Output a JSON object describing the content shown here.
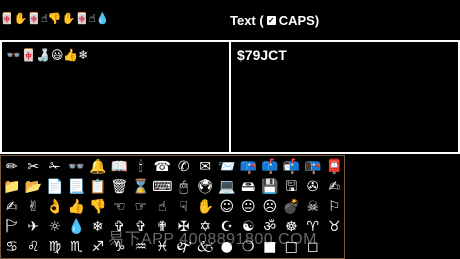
{
  "header": {
    "emoji_strip": "🀄✋🀄☝👎✋🀄☝💧",
    "text_label_prefix": "Text (",
    "checkbox_mark": "✓",
    "caps_label": " CAPS)"
  },
  "left_panel": {
    "emoji_row": "👓🀄🍶😃👍❄"
  },
  "right_panel": {
    "value": "$79JCT"
  },
  "symbol_grid": {
    "rows": [
      [
        "✏",
        "✂",
        "✁",
        "👓",
        "🔔",
        "📖",
        "🕯",
        "☎",
        "✆",
        "✉",
        "📨",
        "📪",
        "📫",
        "📬",
        "📭",
        "📮"
      ],
      [
        "📁",
        "📂",
        "📄",
        "📃",
        "📋",
        "🗑",
        "⌛",
        "⌨",
        "🖱",
        "🖲",
        "💻",
        "🖴",
        "💾",
        "🖫",
        "✇",
        "✍"
      ],
      [
        "✍",
        "✌",
        "👌",
        "👍",
        "👎",
        "☜",
        "☞",
        "☝",
        "☟",
        "✋",
        "☺",
        "😐",
        "☹",
        "💣",
        "☠",
        "⚐"
      ],
      [
        "🏱",
        "✈",
        "☼",
        "💧",
        "❄",
        "✞",
        "✞",
        "✟",
        "✠",
        "✡",
        "☪",
        "☯",
        "ॐ",
        "☸",
        "♈",
        "♉"
      ],
      [
        "♋",
        "♌",
        "♍",
        "♏",
        "♐",
        "♑",
        "♒",
        "♓",
        "🙰",
        "🙵",
        "●",
        "❍",
        "■",
        "□",
        "◻",
        ""
      ]
    ]
  },
  "watermark": "易下APP 4008891800.COM"
}
